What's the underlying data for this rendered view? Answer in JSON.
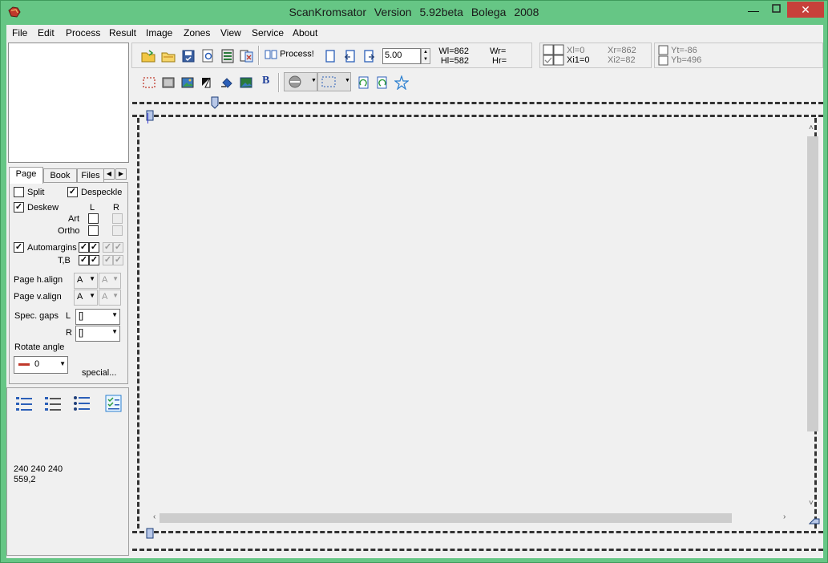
{
  "window": {
    "title": "ScanKromsator    Version 5.92beta    Bolega 2008",
    "minimize": "—",
    "maximize": "□",
    "close": "✕"
  },
  "menu": [
    "File",
    "Edit",
    "Process",
    "Result",
    "Image",
    "Zones",
    "View",
    "Service",
    "About"
  ],
  "tabs": {
    "page": "Page",
    "book": "Book",
    "files": "Files"
  },
  "page_panel": {
    "split": "Split",
    "despeckle": "Despeckle",
    "deskew": "Deskew",
    "col_l": "L",
    "col_r": "R",
    "art": "Art",
    "ortho": "Ortho",
    "automargins": "Automargins",
    "tb": "T,B",
    "page_halign": "Page h.align",
    "page_valign": "Page v.align",
    "halign_value": "A",
    "valign_value": "A",
    "spec_gaps": "Spec. gaps",
    "gap_l_label": "L",
    "gap_r_label": "R",
    "gap_l_value": "[]",
    "gap_r_value": "[]",
    "rotate_angle": "Rotate angle",
    "rotate_value": "0",
    "special": "special...",
    "checked": {
      "split": false,
      "despeckle": true,
      "deskew": true,
      "automargins": true
    }
  },
  "status": {
    "line1": "240 240 240",
    "line2": "559,2"
  },
  "toolbar": {
    "process_label": "Process!",
    "zoom_value": "5.00",
    "wl": "Wl=862",
    "hl": "Hl=582",
    "wr": "Wr=",
    "hr": "Hr=",
    "xl": "Xl=0",
    "xi1": "Xi1=0",
    "xr": "Xr=862",
    "xi2": "Xi2=82",
    "yt": "Yt=-86",
    "yb": "Yb=496"
  },
  "icons": {
    "app": "app-logo-icon",
    "open": "open-folder-icon",
    "open2": "open-folder-alt-icon",
    "save": "save-check-icon",
    "preview": "preview-icon",
    "list": "list-doc-icon",
    "batch": "batch-icon"
  }
}
